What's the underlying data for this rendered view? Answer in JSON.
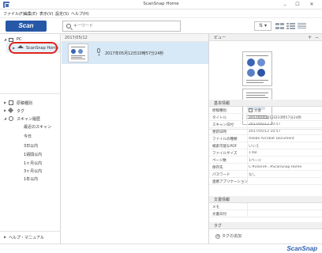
{
  "window": {
    "title": "ScanSnap Home",
    "min": "–",
    "max": "☐",
    "close": "✕"
  },
  "menu": [
    "ファイル(F)",
    "編集(E)",
    "表示(V)",
    "設定(S)",
    "ヘルプ(H)"
  ],
  "toolbar": {
    "scan_label": "Scan",
    "search_placeholder": "キーワード",
    "sort_label": "⇅ ▾"
  },
  "sidebar": {
    "pc_label": "PC",
    "home_label": "ScanSnap Home",
    "filters": [
      {
        "label": "原稿種別"
      },
      {
        "label": "タグ"
      },
      {
        "label": "スキャン履歴"
      }
    ],
    "history": [
      "最近のスキャン",
      "今日",
      "3日以内",
      "1週間以内",
      "1ヶ月以内",
      "3ヶ月以内",
      "1年以内"
    ],
    "help_label": "ヘルプ・マニュアル"
  },
  "content": {
    "group_label": "2017/05/12",
    "file_name": "2017年05月12日10時57分24秒"
  },
  "rpanel": {
    "preview_label": "ビュー",
    "zoom_in": "+",
    "zoom_out": "−",
    "basic_label": "基本情報",
    "basic": [
      {
        "k": "原稿種別",
        "v": "文書"
      },
      {
        "k": "タイトル",
        "v": "2017年05月12日10時57分24秒"
      },
      {
        "k": "スキャン日付",
        "v": "2017/05/12 10:57"
      },
      {
        "k": "更新日時",
        "v": "2017/05/12 10:57"
      },
      {
        "k": "ファイルの種類",
        "v": "Adobe Acrobat Document"
      },
      {
        "k": "検索可能なPDF",
        "v": "いいえ"
      },
      {
        "k": "ファイルサイズ",
        "v": "1 KB"
      },
      {
        "k": "ページ数",
        "v": "1ページ"
      },
      {
        "k": "保存先",
        "v": "C:¥Users¥...¥ScanSnap Home"
      },
      {
        "k": "パスワード",
        "v": "なし"
      },
      {
        "k": "連携アプリケーション",
        "v": ""
      }
    ],
    "doc_label": "文書情報",
    "doc": [
      {
        "k": "メモ",
        "v": ""
      },
      {
        "k": "文書日付",
        "v": ""
      }
    ],
    "tag_label": "タグ",
    "tag_add": "タグの追加"
  },
  "brand": "ScanSnap"
}
